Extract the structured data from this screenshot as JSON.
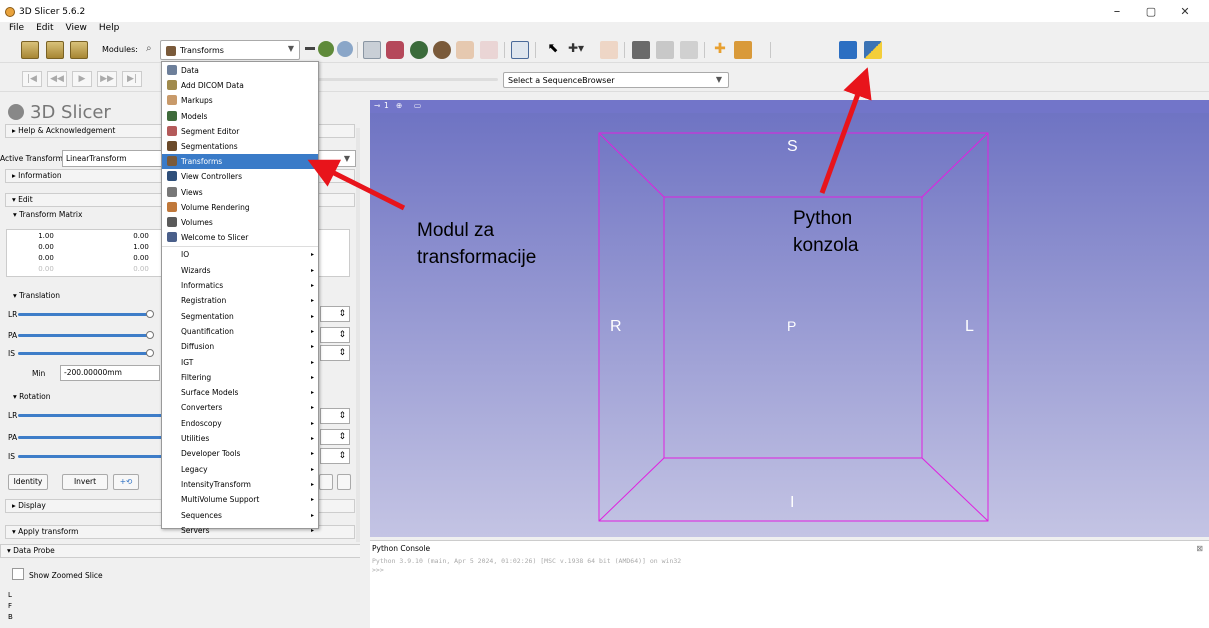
{
  "window": {
    "title": "3D Slicer 5.6.2",
    "min": "–",
    "max": "▢",
    "close": "✕"
  },
  "menubar": [
    "File",
    "Edit",
    "View",
    "Help"
  ],
  "toolbar": {
    "modules_label": "Modules:",
    "module_selected": "Transforms",
    "sequence_browser": "Select a SequenceBrowser"
  },
  "left": {
    "logo": "3D Slicer",
    "help": "Help & Acknowledgement",
    "active_transform_label": "Active Transform:",
    "active_transform": "LinearTransform",
    "information": "Information",
    "edit": "Edit",
    "transform_matrix": "Transform Matrix",
    "matrix": [
      [
        "1.00",
        "0.00"
      ],
      [
        "0.00",
        "1.00"
      ],
      [
        "0.00",
        "0.00"
      ],
      [
        "0.00",
        "0.00"
      ]
    ],
    "translation": "Translation",
    "axes": [
      "LR",
      "PA",
      "IS"
    ],
    "min_label": "Min",
    "min_value": "-200.00000mm",
    "rotation": "Rotation",
    "identity": "Identity",
    "invert": "Invert",
    "display": "Display",
    "apply_transform": "Apply transform",
    "data_probe": "Data Probe",
    "show_zoomed": "Show Zoomed Slice",
    "probe_lines": [
      "L",
      "F",
      "B"
    ]
  },
  "dropdown": {
    "items": [
      {
        "label": "Data",
        "color": "#6d7f9a"
      },
      {
        "label": "Add DICOM Data",
        "color": "#a08a4c"
      },
      {
        "label": "Markups",
        "color": "#c89a6a"
      },
      {
        "label": "Models",
        "color": "#3f6b3b"
      },
      {
        "label": "Segment Editor",
        "color": "#b45a5a"
      },
      {
        "label": "Segmentations",
        "color": "#6b4a2a"
      },
      {
        "label": "Transforms",
        "color": "#7a5a3a"
      },
      {
        "label": "View Controllers",
        "color": "#2f4f7a"
      },
      {
        "label": "Views",
        "color": "#777777"
      },
      {
        "label": "Volume Rendering",
        "color": "#c0783a"
      },
      {
        "label": "Volumes",
        "color": "#5a5a5a"
      },
      {
        "label": "Welcome to Slicer",
        "color": "#4a5f8a"
      }
    ],
    "categories": [
      "IO",
      "Wizards",
      "Informatics",
      "Registration",
      "Segmentation",
      "Quantification",
      "Diffusion",
      "IGT",
      "Filtering",
      "Surface Models",
      "Converters",
      "Endoscopy",
      "Utilities",
      "Developer Tools",
      "Legacy",
      "IntensityTransform",
      "MultiVolume Support",
      "Sequences",
      "Servers"
    ],
    "submenu_arrow": "▸"
  },
  "view3d": {
    "labels": {
      "S": "S",
      "R": "R",
      "P": "P",
      "L": "L",
      "I": "I"
    },
    "toolbar_number": "1"
  },
  "console": {
    "header": "Python Console",
    "line1": "Python 3.9.10 (main, Apr  5 2024, 01:02:26) [MSC v.1938 64 bit (AMD64)] on win32",
    "line2": ">>>"
  },
  "annotations": {
    "module_line1": "Modul za",
    "module_line2": "transformacije",
    "python_line1": "Python",
    "python_line2": "konzola",
    "arrow_color": "#e8141b"
  }
}
